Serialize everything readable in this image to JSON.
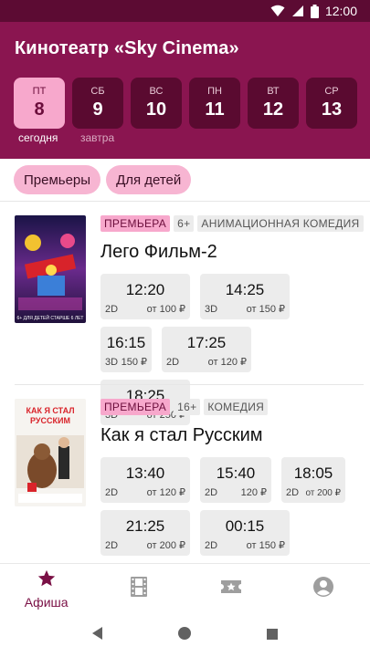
{
  "status": {
    "time": "12:00"
  },
  "header": {
    "title": "Кинотеатр «Sky Cinema»",
    "days": [
      {
        "dow": "ПТ",
        "num": "8",
        "active": true
      },
      {
        "dow": "СБ",
        "num": "9"
      },
      {
        "dow": "ВС",
        "num": "10"
      },
      {
        "dow": "ПН",
        "num": "11"
      },
      {
        "dow": "ВТ",
        "num": "12"
      },
      {
        "dow": "СР",
        "num": "13"
      }
    ],
    "today_label": "сегодня",
    "tomorrow_label": "завтра"
  },
  "filters": [
    "Премьеры",
    "Для детей"
  ],
  "movies": [
    {
      "badges": [
        "ПРЕМЬЕРА",
        "6+",
        "АНИМАЦИОННАЯ КОМЕДИЯ"
      ],
      "title": "Лего Фильм-2",
      "poster_text": "6+ ДЛЯ ДЕТЕЙ СТАРШЕ 6 ЛЕТ",
      "sessions": [
        {
          "time": "12:20",
          "format": "2D",
          "price": "от 100 ₽"
        },
        {
          "time": "14:25",
          "format": "3D",
          "price": "от 150 ₽"
        },
        {
          "time": "16:15",
          "format": "3D",
          "price": "150 ₽"
        },
        {
          "time": "17:25",
          "format": "2D",
          "price": "от 120 ₽"
        },
        {
          "time": "18:25",
          "format": "3D",
          "price": "от 250 ₽"
        }
      ]
    },
    {
      "badges": [
        "ПРЕМЬЕРА",
        "16+",
        "КОМЕДИЯ"
      ],
      "title": "Как я стал Русским",
      "poster_text": "КАК Я СТАЛ РУССКИМ",
      "sessions": [
        {
          "time": "13:40",
          "format": "2D",
          "price": "от 120 ₽"
        },
        {
          "time": "15:40",
          "format": "2D",
          "price": "120 ₽"
        },
        {
          "time": "18:05",
          "format": "2D",
          "price": "от 200 ₽"
        },
        {
          "time": "21:25",
          "format": "2D",
          "price": "от 200 ₽"
        },
        {
          "time": "00:15",
          "format": "2D",
          "price": "от 150 ₽"
        }
      ]
    }
  ],
  "bottom_nav": {
    "items": [
      {
        "label": "Афиша",
        "icon": "star-icon",
        "active": true
      },
      {
        "label": "",
        "icon": "film-icon"
      },
      {
        "label": "",
        "icon": "ticket-icon"
      },
      {
        "label": "",
        "icon": "account-icon"
      }
    ]
  },
  "colors": {
    "header": "#8a1550",
    "statusbar": "#5c0b33",
    "accent": "#f7a8cc",
    "active_nav": "#7a1045"
  }
}
